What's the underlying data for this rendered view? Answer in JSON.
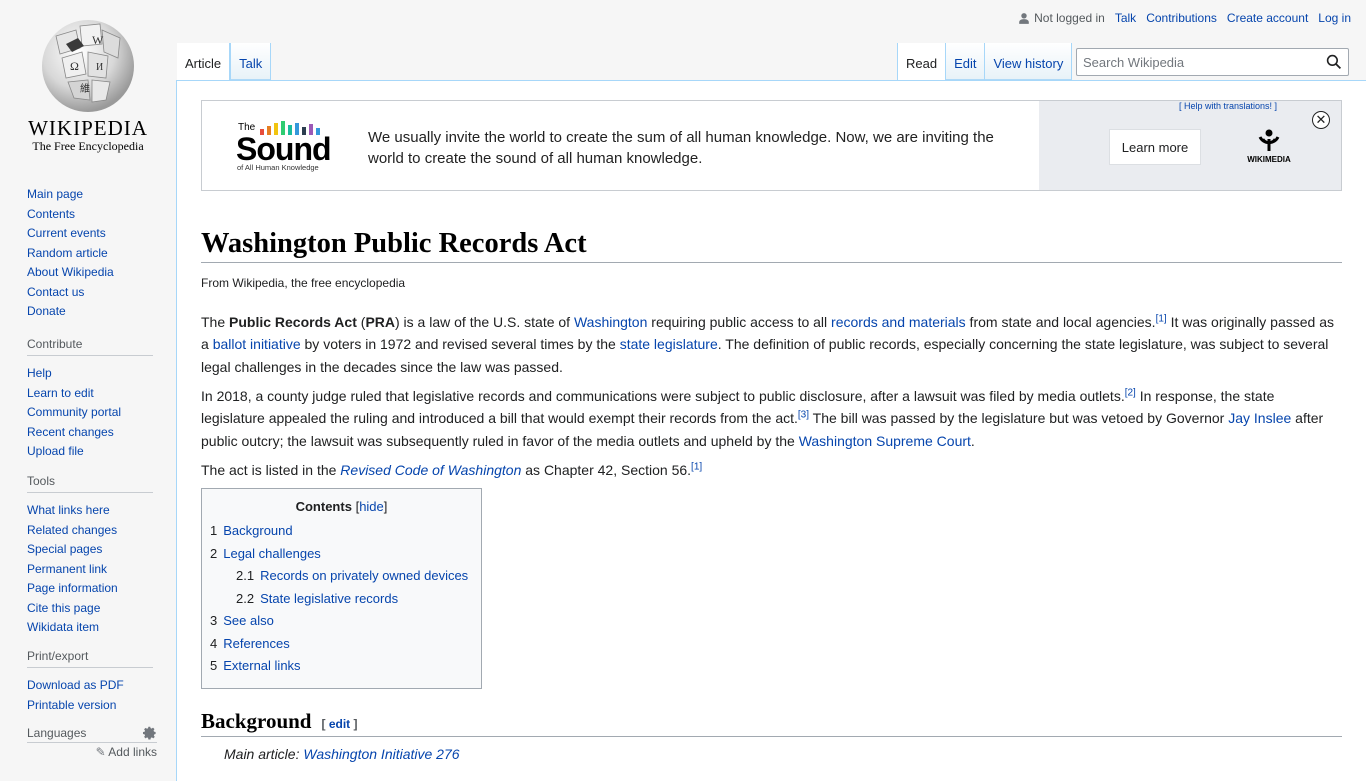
{
  "logo": {
    "wordmark": "WIKIPEDIA",
    "tagline": "The Free Encyclopedia"
  },
  "sidebar": {
    "navigation": [
      "Main page",
      "Contents",
      "Current events",
      "Random article",
      "About Wikipedia",
      "Contact us",
      "Donate"
    ],
    "contribute": {
      "heading": "Contribute",
      "items": [
        "Help",
        "Learn to edit",
        "Community portal",
        "Recent changes",
        "Upload file"
      ]
    },
    "tools": {
      "heading": "Tools",
      "items": [
        "What links here",
        "Related changes",
        "Special pages",
        "Permanent link",
        "Page information",
        "Cite this page",
        "Wikidata item"
      ]
    },
    "print": {
      "heading": "Print/export",
      "items": [
        "Download as PDF",
        "Printable version"
      ]
    },
    "languages": {
      "heading": "Languages",
      "add_links": "Add links"
    }
  },
  "personal": {
    "not_logged": "Not logged in",
    "talk": "Talk",
    "contributions": "Contributions",
    "create_account": "Create account",
    "login": "Log in"
  },
  "tabs": {
    "article": "Article",
    "talk": "Talk",
    "read": "Read",
    "edit": "Edit",
    "history": "View history"
  },
  "search": {
    "placeholder": "Search Wikipedia"
  },
  "banner": {
    "logo_top": "The",
    "logo_main": "Sound",
    "logo_sub": "of All Human Knowledge",
    "message": "We usually invite the world to create the sum of all human knowledge. Now, we are inviting the world to create the sound of all human knowledge.",
    "help": "[ Help with translations! ]",
    "learn_more": "Learn more",
    "wikimedia": "WIKIMEDIA",
    "close": "✕"
  },
  "article": {
    "title": "Washington Public Records Act",
    "tagline": "From Wikipedia, the free encyclopedia",
    "p1": {
      "a": "The ",
      "b": "Public Records Act",
      "c": " (",
      "d": "PRA",
      "e": ") is a law of the U.S. state of ",
      "l1": "Washington",
      "f": " requiring public access to all ",
      "l2": "records and materials",
      "g": " from state and local agencies.",
      "r1": "[1]",
      "h": " It was originally passed as a ",
      "l3": "ballot initiative",
      "i": " by voters in 1972 and revised several times by the ",
      "l4": "state legislature",
      "j": ". The definition of public records, especially concerning the state legislature, was subject to several legal challenges in the decades since the law was passed."
    },
    "p2": {
      "a": "In 2018, a county judge ruled that legislative records and communications were subject to public disclosure, after a lawsuit was filed by media outlets.",
      "r2": "[2]",
      "b": " In response, the state legislature appealed the ruling and introduced a bill that would exempt their records from the act.",
      "r3": "[3]",
      "c": " The bill was passed by the legislature but was vetoed by Governor ",
      "l1": "Jay Inslee",
      "d": " after public outcry; the lawsuit was subsequently ruled in favor of the media outlets and upheld by the ",
      "l2": "Washington Supreme Court",
      "e": "."
    },
    "p3": {
      "a": "The act is listed in the ",
      "l1": "Revised Code of Washington",
      "b": " as Chapter 42, Section 56.",
      "r1": "[1]"
    },
    "toc": {
      "title": "Contents",
      "hide": "hide",
      "items": [
        {
          "num": "1",
          "label": "Background"
        },
        {
          "num": "2",
          "label": "Legal challenges"
        },
        {
          "num": "2.1",
          "label": "Records on privately owned devices"
        },
        {
          "num": "2.2",
          "label": "State legislative records"
        },
        {
          "num": "3",
          "label": "See also"
        },
        {
          "num": "4",
          "label": "References"
        },
        {
          "num": "5",
          "label": "External links"
        }
      ]
    },
    "section": {
      "title": "Background",
      "edit": "edit",
      "main_label": "Main article: ",
      "main_link": "Washington Initiative 276"
    }
  }
}
